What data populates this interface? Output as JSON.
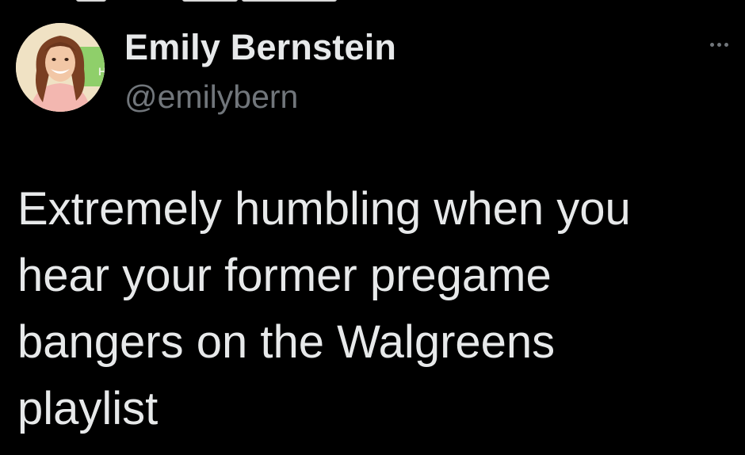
{
  "tweet": {
    "author": {
      "display_name": "Emily Bernstein",
      "handle": "@emilybern",
      "avatar_icon": "profile-photo"
    },
    "text_lines": [
      "Extremely humbling when you",
      "hear your former pregame",
      "bangers on the Walgreens",
      "playlist"
    ],
    "menu_icon": "more-options-icon"
  },
  "colors": {
    "background": "#000000",
    "primary_text": "#e7e9ea",
    "secondary_text": "#71767b"
  }
}
